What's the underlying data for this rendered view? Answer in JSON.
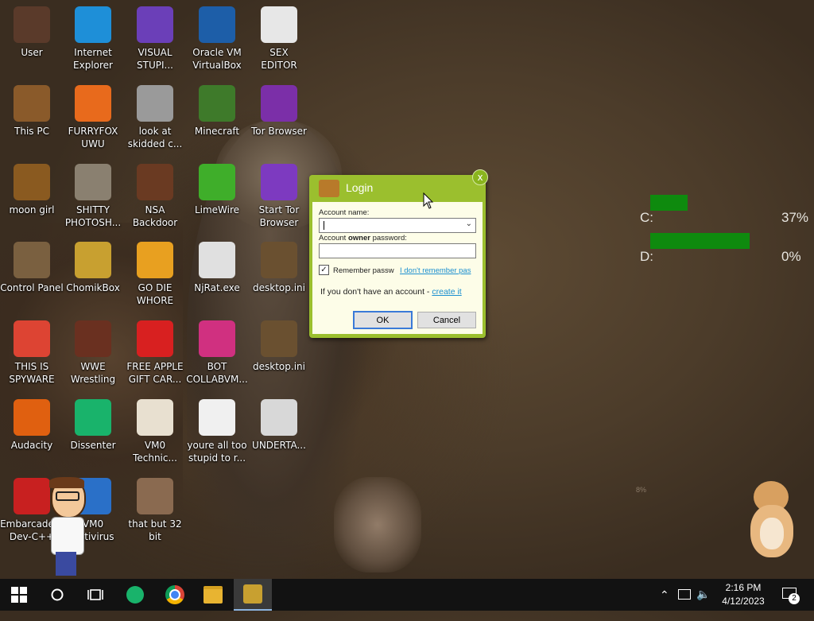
{
  "desktop": {
    "icons": [
      {
        "label": "User",
        "icon": "user-figure-icon",
        "color": "#5a3a2a"
      },
      {
        "label": "Internet\nExplorer",
        "icon": "edge-icon",
        "color": "#1e8fd8"
      },
      {
        "label": "VISUAL\nSTUPI...",
        "icon": "visual-studio-icon",
        "color": "#6b3fb8"
      },
      {
        "label": "Oracle VM\nVirtualBox",
        "icon": "virtualbox-icon",
        "color": "#1d5ea8"
      },
      {
        "label": "SEX\nEDITOR",
        "icon": "hxd-editor-icon",
        "color": "#e7e7e7"
      },
      {
        "label": "This PC",
        "icon": "this-pc-icon",
        "color": "#8a5a2a"
      },
      {
        "label": "FURRYFOX\nUWU",
        "icon": "firefox-icon",
        "color": "#e86a1c"
      },
      {
        "label": "look at\nskidded c...",
        "icon": "copy-windows-icon",
        "color": "#9a9a9a"
      },
      {
        "label": "Minecraft",
        "icon": "minecraft-icon",
        "color": "#3e7a2a"
      },
      {
        "label": "Tor Browser",
        "icon": "tor-browser-icon",
        "color": "#7b2fa8"
      },
      {
        "label": "moon girl",
        "icon": "folder-book-icon",
        "color": "#8a5a20"
      },
      {
        "label": "SHITTY\nPHOTOSH...",
        "icon": "gimp-icon",
        "color": "#8a8070"
      },
      {
        "label": "NSA\nBackdoor",
        "icon": "picture-frame-icon",
        "color": "#6a3a22"
      },
      {
        "label": "LimeWire",
        "icon": "limewire-icon",
        "color": "#3fae2a"
      },
      {
        "label": "Start Tor\nBrowser",
        "icon": "tor-onion-icon",
        "color": "#7d3ac0"
      },
      {
        "label": "Control Panel",
        "icon": "lightbulb-icon",
        "color": "#7a6040"
      },
      {
        "label": "ChomikBox",
        "icon": "chomikbox-icon",
        "color": "#c8a030"
      },
      {
        "label": "GO DIE\nWHORE",
        "icon": "de-letters-icon",
        "color": "#e8a020"
      },
      {
        "label": "NjRat.exe",
        "icon": "skull-icon",
        "color": "#e0e0e0"
      },
      {
        "label": "desktop.ini",
        "icon": "settings-file-icon",
        "color": "#6a5030"
      },
      {
        "label": "THIS IS\nSPYWARE",
        "icon": "chrome-icon",
        "color": "#dd4433"
      },
      {
        "label": "WWE\nWrestling",
        "icon": "tv-icon",
        "color": "#6a3020"
      },
      {
        "label": "FREE APPLE\nGIFT CAR...",
        "icon": "apple-icon",
        "color": "#d82020"
      },
      {
        "label": "BOT\nCOLLABVM...",
        "icon": "monitor-icon",
        "color": "#d03080"
      },
      {
        "label": "desktop.ini",
        "icon": "settings-file-icon",
        "color": "#6a5030"
      },
      {
        "label": "Audacity",
        "icon": "audacity-icon",
        "color": "#e06010"
      },
      {
        "label": "Dissenter",
        "icon": "dissenter-icon",
        "color": "#19b36b"
      },
      {
        "label": "VM0\nTechnic...",
        "icon": "technician-icon",
        "color": "#e8e0d0"
      },
      {
        "label": "youre all too\nstupid to r...",
        "icon": "portrait-icon",
        "color": "#f0f0f0"
      },
      {
        "label": "UNDERTA...",
        "icon": "unity-icon",
        "color": "#d8d8d8"
      },
      {
        "label": "Embarcadero\nDev-C++",
        "icon": "devcpp-icon",
        "color": "#c82020"
      },
      {
        "label": "VM0\nAntivirus",
        "icon": "shield-icon",
        "color": "#2a70c8"
      },
      {
        "label": "that but 32\nbit",
        "icon": "portrait-icon",
        "color": "#8a6a50"
      }
    ]
  },
  "drives": {
    "c_label": "C:",
    "c_percent": "37%",
    "c_fill": 0.37,
    "d_label": "D:",
    "d_percent": "0%",
    "d_fill": 0.0,
    "bar_color": "#0e8a0e"
  },
  "small_meter": "8%",
  "login": {
    "title": "Login",
    "account_name_label": "Account name:",
    "account_name_value": "",
    "password_label_pre": "Account ",
    "password_label_bold": "owner",
    "password_label_post": " password:",
    "remember_label": "Remember passw",
    "remember_checked": true,
    "forgot_link": "I don't remember pas",
    "no_account_text": "If you don't have an account - ",
    "create_link": "create it",
    "ok_label": "OK",
    "cancel_label": "Cancel",
    "close_label": "x",
    "accent_color": "#9bbf2e"
  },
  "taskbar": {
    "clock_time": "2:16 PM",
    "clock_date": "4/12/2023",
    "notification_count": "2"
  }
}
